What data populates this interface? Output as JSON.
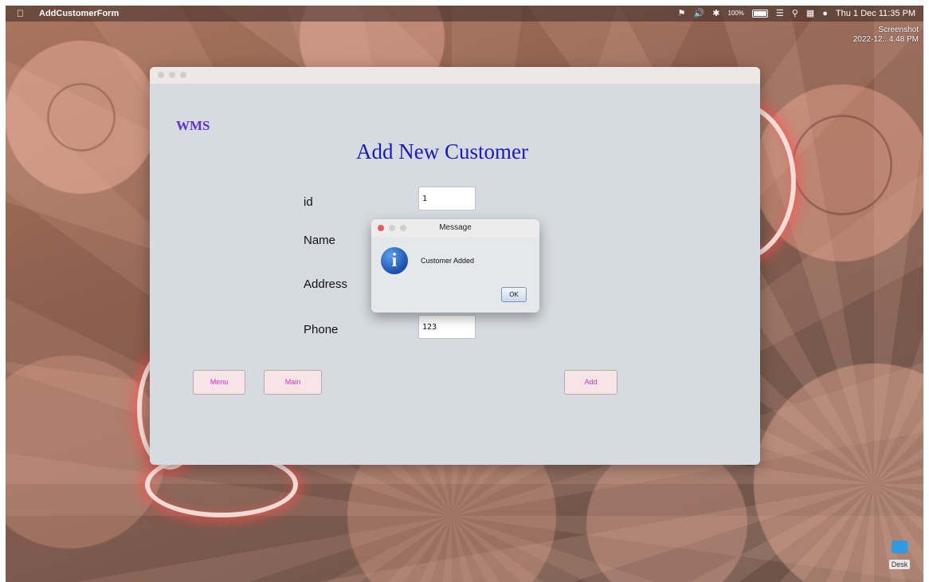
{
  "menubar": {
    "app_name": "AddCustomerForm",
    "battery": "100%",
    "datetime": "Thu 1 Dec  11:35 PM"
  },
  "desktop": {
    "screenshot_label_line1": "Screenshot",
    "screenshot_label_line2": "2022-12...4.48 PM",
    "desk_label": "Desk"
  },
  "window": {
    "brand": "WMS",
    "heading": "Add New Customer",
    "fields": {
      "id": {
        "label": "id",
        "value": "1"
      },
      "name": {
        "label": "Name",
        "value": ""
      },
      "address": {
        "label": "Address",
        "value": ""
      },
      "phone": {
        "label": "Phone",
        "value": "123"
      }
    },
    "buttons": {
      "menu": "Menu",
      "main": "Main",
      "add": "Add"
    }
  },
  "dialog": {
    "title": "Message",
    "message": "Customer Added",
    "ok": "OK"
  },
  "colors": {
    "brand": "#6131d8",
    "heading": "#1a19c9",
    "button_text": "#e02ad8",
    "window_bg": "#d6dbe1",
    "close_red": "#ee5a52"
  },
  "icons": [
    "apple-icon",
    "info-icon",
    "wifi-icon",
    "search-icon",
    "bluetooth-icon",
    "volume-icon"
  ]
}
